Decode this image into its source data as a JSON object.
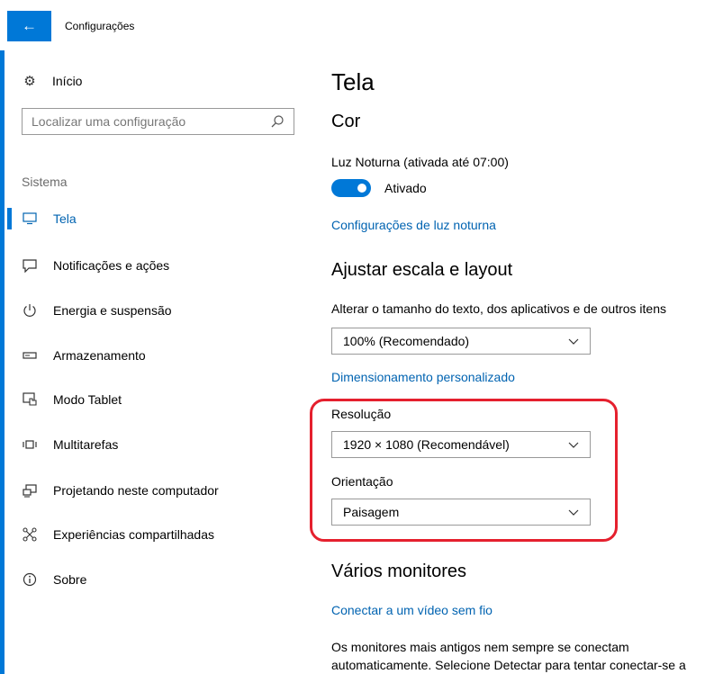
{
  "window": {
    "title": "Configurações"
  },
  "sidebar": {
    "home_label": "Início",
    "search_placeholder": "Localizar uma configuração",
    "section_label": "Sistema",
    "items": [
      {
        "label": "Tela",
        "icon": "monitor-icon",
        "selected": true
      },
      {
        "label": "Notificações e ações",
        "icon": "notification-icon",
        "selected": false
      },
      {
        "label": "Energia e suspensão",
        "icon": "power-icon",
        "selected": false
      },
      {
        "label": "Armazenamento",
        "icon": "storage-icon",
        "selected": false
      },
      {
        "label": "Modo Tablet",
        "icon": "tablet-mode-icon",
        "selected": false
      },
      {
        "label": "Multitarefas",
        "icon": "multitasking-icon",
        "selected": false
      },
      {
        "label": "Projetando neste computador",
        "icon": "projecting-icon",
        "selected": false
      },
      {
        "label": "Experiências compartilhadas",
        "icon": "shared-experiences-icon",
        "selected": false
      },
      {
        "label": "Sobre",
        "icon": "info-icon",
        "selected": false
      }
    ]
  },
  "main": {
    "page_title": "Tela",
    "color_heading": "Cor",
    "night_light_label": "Luz Noturna (ativada até 07:00)",
    "night_light_toggle": {
      "on": true,
      "state_label": "Ativado"
    },
    "night_light_settings_link": "Configurações de luz noturna",
    "scale_heading": "Ajustar escala e layout",
    "scale_description": "Alterar o tamanho do texto, dos aplicativos e de outros itens",
    "scale_dropdown_value": "100% (Recomendado)",
    "custom_scaling_link": "Dimensionamento personalizado",
    "resolution_label": "Resolução",
    "resolution_dropdown_value": "1920 × 1080 (Recomendável)",
    "orientation_label": "Orientação",
    "orientation_dropdown_value": "Paisagem",
    "multiple_displays_heading": "Vários monitores",
    "wireless_display_link": "Conectar a um vídeo sem fio",
    "older_displays_text_line1": "Os monitores mais antigos nem sempre se conectam",
    "older_displays_text_line2": "automaticamente. Selecione Detectar para tentar conectar-se a"
  },
  "colors": {
    "accent": "#0078d7",
    "link": "#0063b1",
    "highlight": "#e5202e"
  }
}
